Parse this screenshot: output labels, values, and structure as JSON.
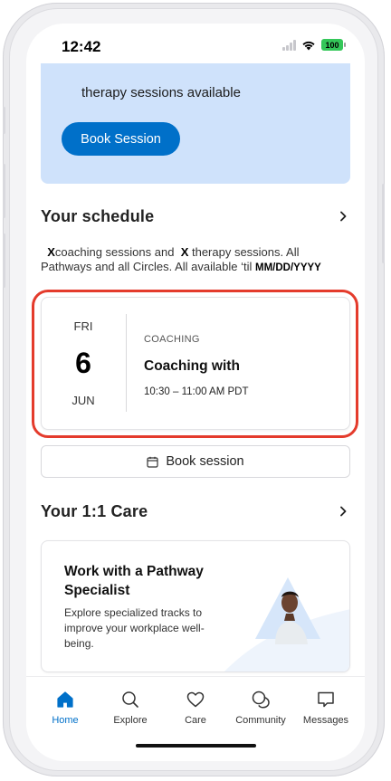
{
  "status_bar": {
    "time": "12:42",
    "battery": "100"
  },
  "promo": {
    "text": "therapy sessions available",
    "button_label": "Book Session"
  },
  "schedule": {
    "title": "Your schedule",
    "desc_count1": "X",
    "desc_part1": "coaching sessions and ",
    "desc_count2": "X",
    "desc_part2": " therapy sessions. All Pathways and all Circles. All available ‘til ",
    "desc_date": "MM/DD/YYYY",
    "appointment": {
      "day_of_week": "FRI",
      "day": "6",
      "month": "JUN",
      "type": "COACHING",
      "title": "Coaching with",
      "time": "10:30 – 11:00 AM PDT"
    },
    "book_button_label": "Book session"
  },
  "care": {
    "title": "Your 1:1 Care",
    "card": {
      "title": "Work with a Pathway Specialist",
      "body": "Explore specialized tracks to improve your workplace well-being."
    }
  },
  "tabs": [
    {
      "label": "Home",
      "icon": "home-icon",
      "active": true
    },
    {
      "label": "Explore",
      "icon": "search-icon",
      "active": false
    },
    {
      "label": "Care",
      "icon": "heart-icon",
      "active": false
    },
    {
      "label": "Community",
      "icon": "chat-bubbles-icon",
      "active": false
    },
    {
      "label": "Messages",
      "icon": "message-icon",
      "active": false
    }
  ],
  "colors": {
    "accent": "#0070c9",
    "promo_bg": "#cfe2fb",
    "highlight": "#e43b2c"
  }
}
